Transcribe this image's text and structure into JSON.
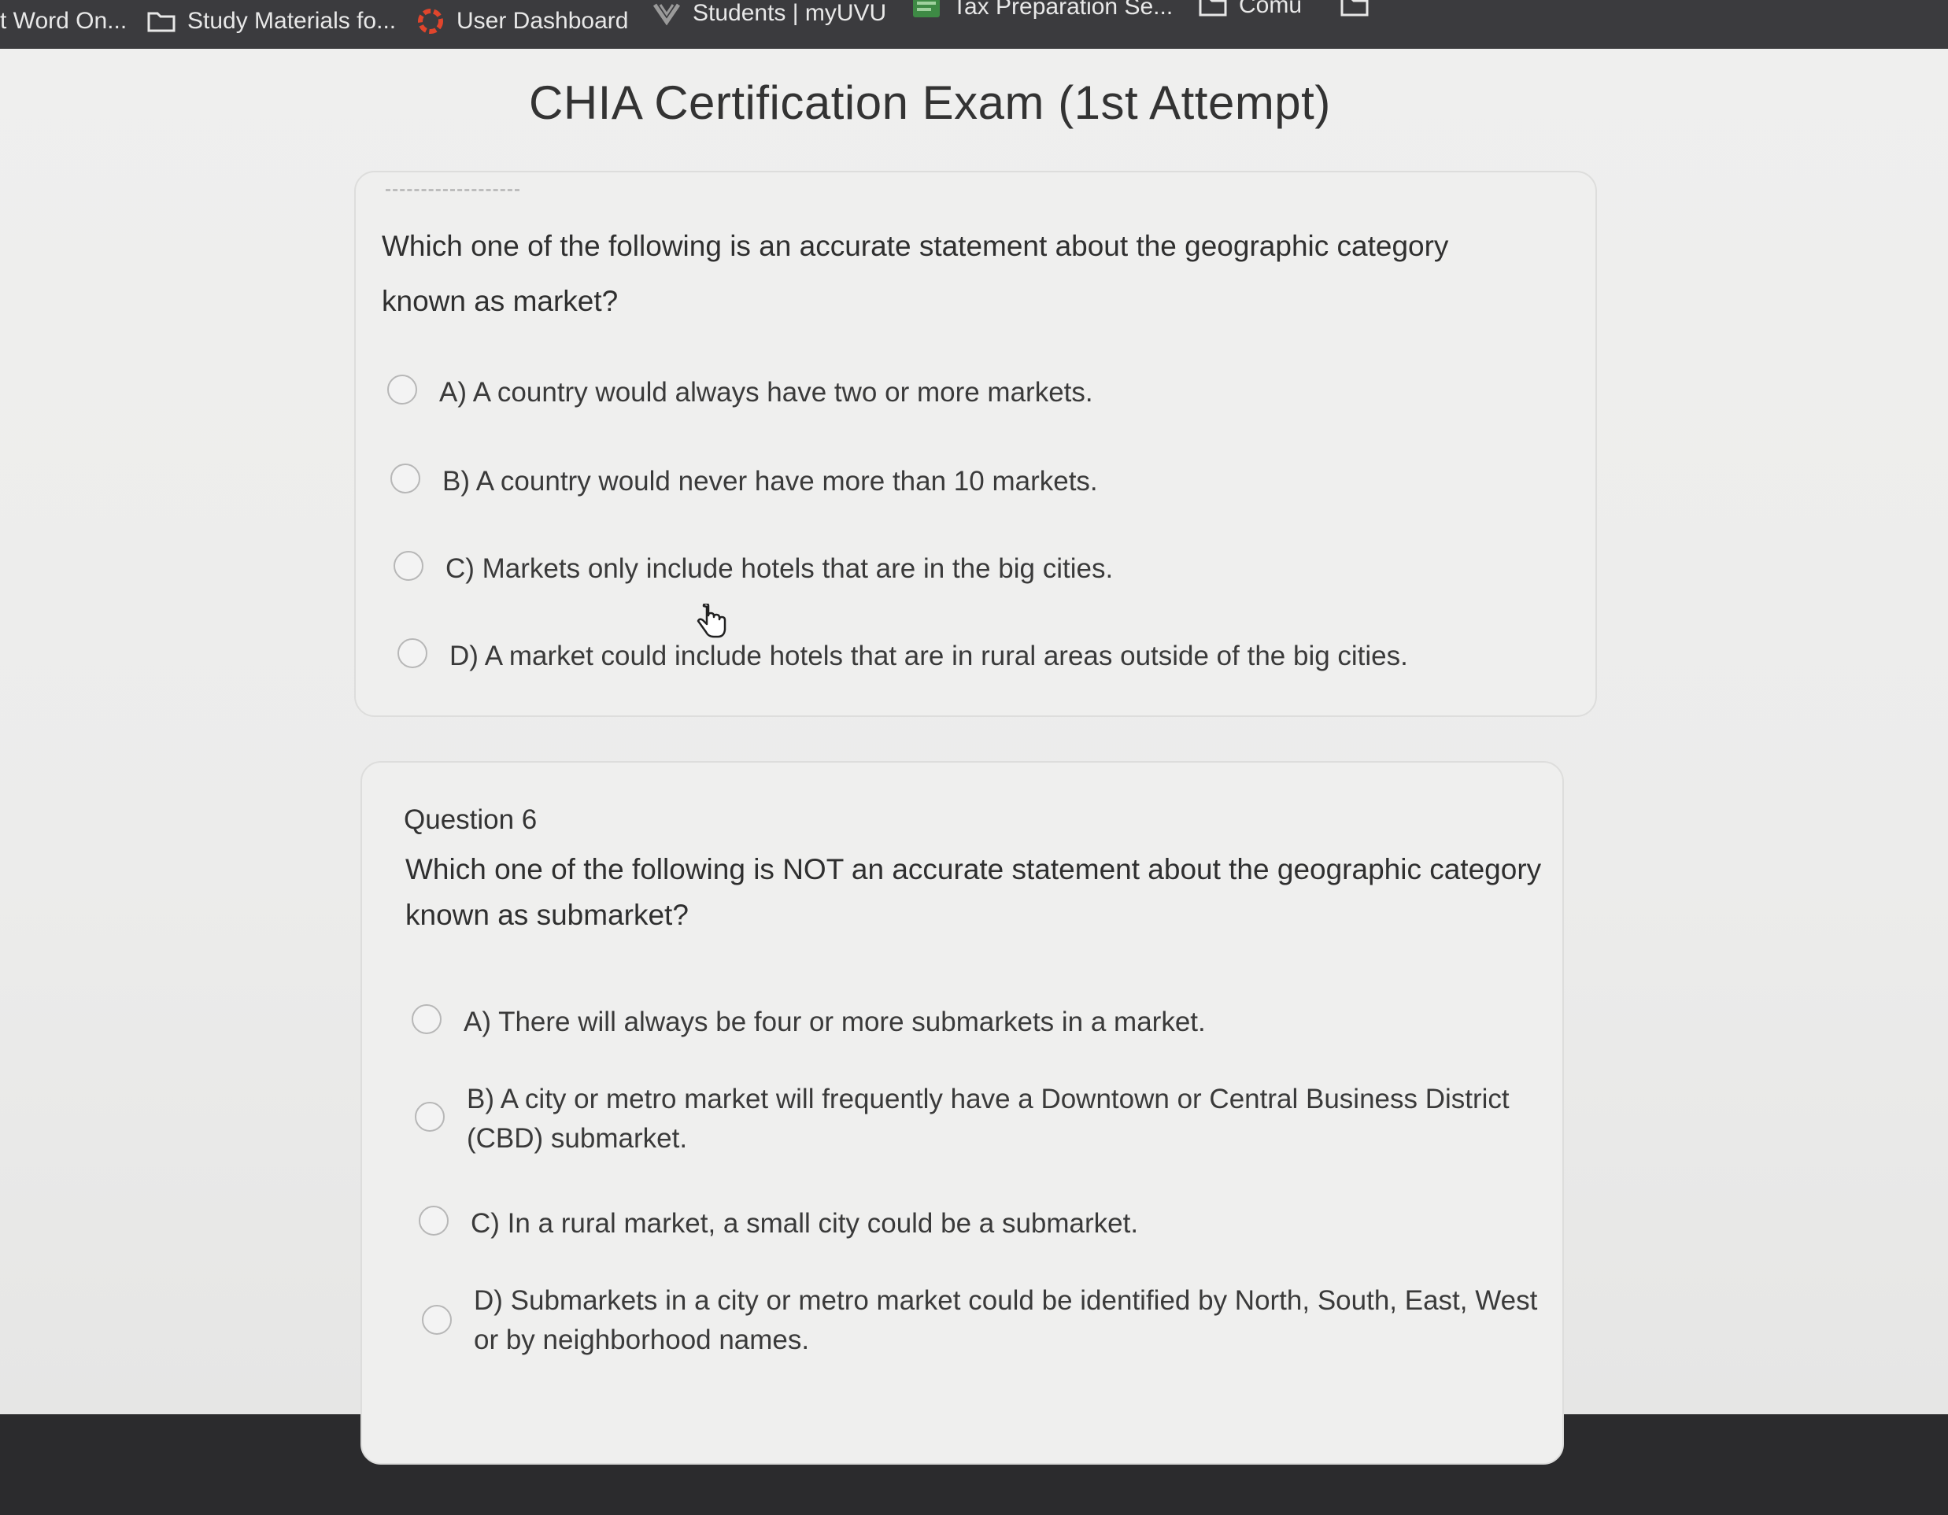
{
  "bookmarks": [
    {
      "label": "t Word On...",
      "icon": "none"
    },
    {
      "label": "Study Materials fo...",
      "icon": "folder-icon"
    },
    {
      "label": "User Dashboard",
      "icon": "dashboard-logo-icon"
    },
    {
      "label": "Students | myUVU",
      "icon": "uvu-logo-icon"
    },
    {
      "label": "Tax Preparation Se...",
      "icon": "tax-site-icon"
    },
    {
      "label": "Comu",
      "icon": "folder-icon"
    },
    {
      "label": "",
      "icon": "folder-icon"
    }
  ],
  "exam": {
    "title": "CHIA Certification Exam (1st Attempt)"
  },
  "questions": [
    {
      "number": "",
      "text_lines": [
        "Which one of the following is an accurate statement about the geographic category",
        "known as market?"
      ],
      "options": [
        {
          "lines": [
            "A) A country would always have two or more markets."
          ]
        },
        {
          "lines": [
            "B) A country would never have more than 10 markets."
          ]
        },
        {
          "lines": [
            "C) Markets only include hotels that are in the big cities."
          ]
        },
        {
          "lines": [
            "D) A market could include hotels that are in rural areas outside of the big cities."
          ]
        }
      ]
    },
    {
      "number": "Question 6",
      "text_lines": [
        "Which one of the following is NOT an accurate statement about the geographic category",
        "known as submarket?"
      ],
      "options": [
        {
          "lines": [
            "A) There will always be four or more submarkets in a market."
          ]
        },
        {
          "lines": [
            "B) A city or metro market will frequently have a Downtown or Central Business District",
            "(CBD) submarket."
          ]
        },
        {
          "lines": [
            "C) In a rural market, a small city could be a submarket."
          ]
        },
        {
          "lines": [
            "D) Submarkets in a city or metro market could be identified by North, South, East, West",
            "or by neighborhood names."
          ]
        }
      ]
    }
  ],
  "colors": {
    "bookmarks_bg": "#3b3b3e",
    "page_bg": "#efefee",
    "dashboard_logo": "#e0452c"
  }
}
